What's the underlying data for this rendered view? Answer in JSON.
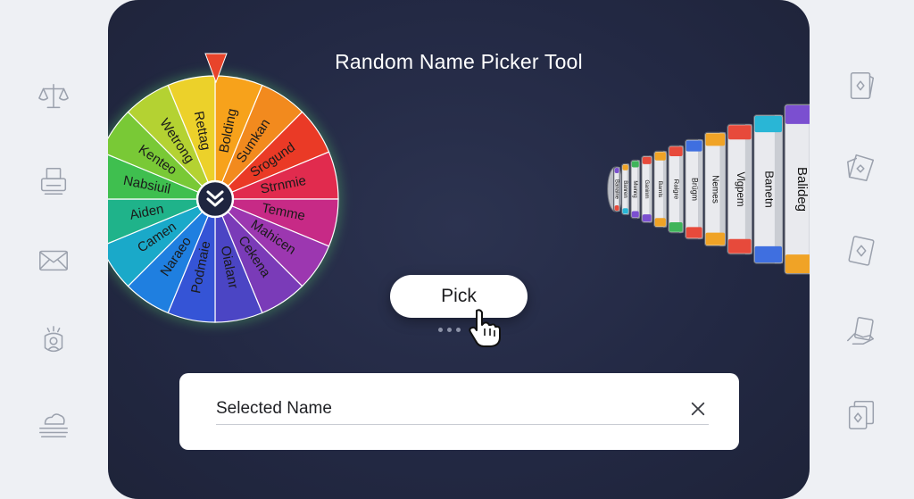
{
  "title": "Random Name Picker Tool",
  "wheel": {
    "slices": [
      {
        "name": "Bolding",
        "color": "#f7a21b"
      },
      {
        "name": "Sumkan",
        "color": "#f28a1e"
      },
      {
        "name": "Srogund",
        "color": "#ea3a26"
      },
      {
        "name": "Strnmie",
        "color": "#e12b4e"
      },
      {
        "name": "Temme",
        "color": "#c72a86"
      },
      {
        "name": "Mahicen",
        "color": "#9c37b0"
      },
      {
        "name": "Cekena",
        "color": "#7a3bb8"
      },
      {
        "name": "Oialanr",
        "color": "#4b45c4"
      },
      {
        "name": "Podmaie",
        "color": "#3554d6"
      },
      {
        "name": "Naraeo",
        "color": "#1f7fe0"
      },
      {
        "name": "Camen",
        "color": "#1aa9c9"
      },
      {
        "name": "Aiden",
        "color": "#1fb38a"
      },
      {
        "name": "Nabsiuil",
        "color": "#3fbf4f"
      },
      {
        "name": "Kenteo",
        "color": "#79c936"
      },
      {
        "name": "Wetrong",
        "color": "#b4d232"
      },
      {
        "name": "Rettag",
        "color": "#ecd12a"
      }
    ],
    "center_icon": "double-chevron-down-icon",
    "pointer_color": "#e8442b"
  },
  "drum": {
    "names": [
      "Balideg",
      "Banetn",
      "Vlgpem",
      "Nemes",
      "Brügm",
      "Raigre",
      "Bamls",
      "Ganinm",
      "Mwnng",
      "Banren",
      "Banaine"
    ],
    "cap_colors": [
      "#7b4fd0",
      "#29b6d6",
      "#e74a3b",
      "#f0a326",
      "#3f6fe0",
      "#e74a3b",
      "#f0a326",
      "#e74a3b",
      "#3fb45a",
      "#f0a326",
      "#7b4fd0"
    ]
  },
  "pick_button": {
    "label": "Pick"
  },
  "result": {
    "label": "Selected Name",
    "clear_icon": "close-icon"
  },
  "left_icons": [
    "scales-icon",
    "printer-icon",
    "mail-icon",
    "person-badge-icon",
    "cloud-layers-icon"
  ],
  "right_icons": [
    "playing-card-icon",
    "playing-cards-icon",
    "card-diamond-icon",
    "cards-hand-icon",
    "card-deck-icon"
  ]
}
